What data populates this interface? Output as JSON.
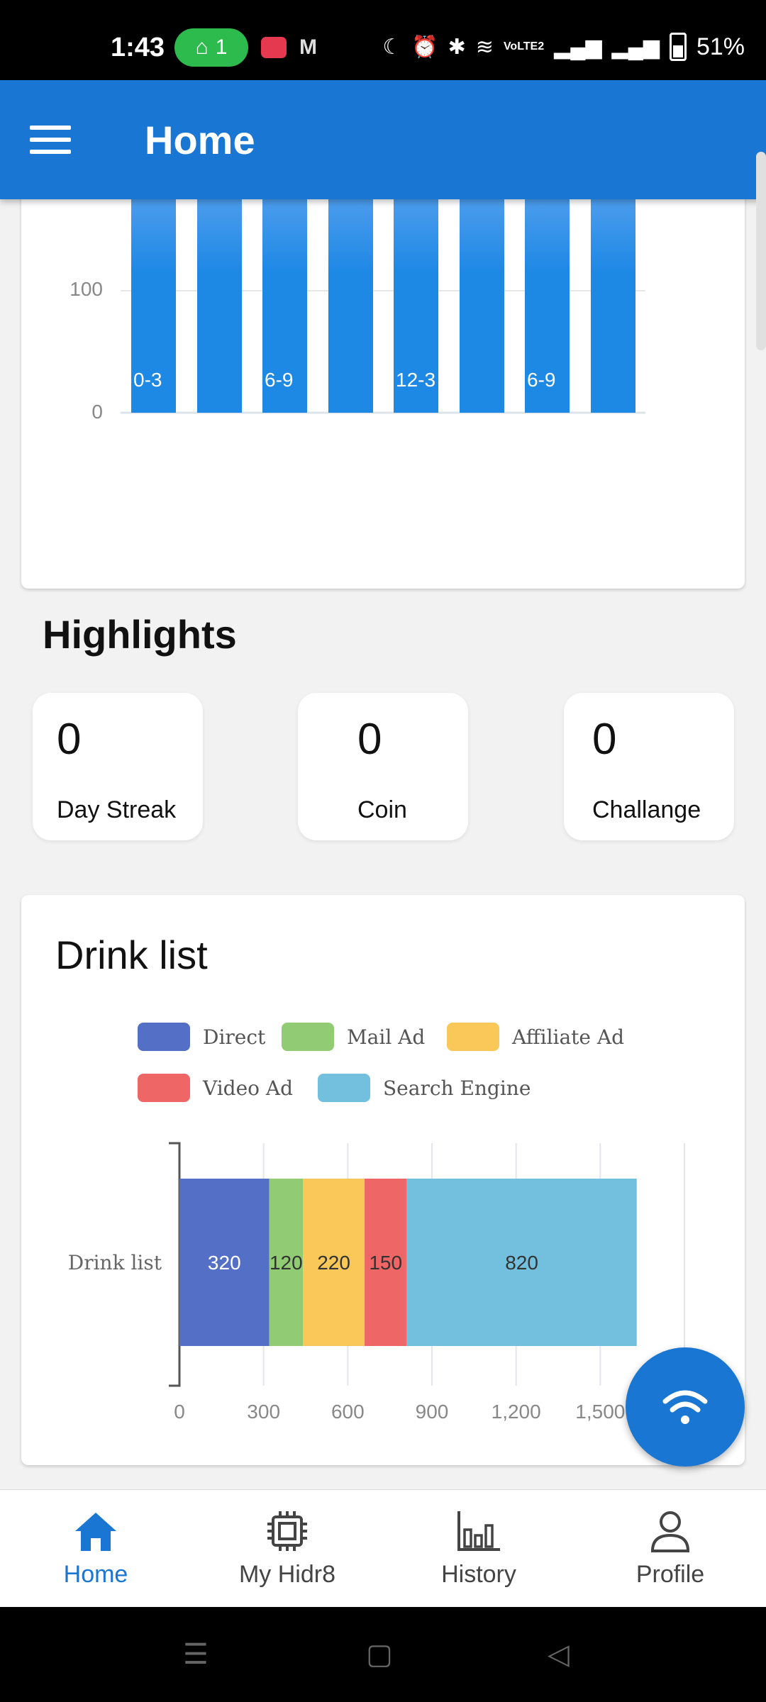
{
  "status_bar": {
    "time": "1:43",
    "hotspot_count": "1",
    "battery": "51%",
    "network": "VoLTE2"
  },
  "app_bar": {
    "title": "Home"
  },
  "usage_chart": {
    "y_ticks": [
      "100",
      "0"
    ],
    "bar_labels": [
      "0-3",
      "",
      "6-9",
      "",
      "12-3",
      "",
      "6-9",
      ""
    ],
    "bar_color": "#1e88e5"
  },
  "highlights": {
    "title": "Highlights",
    "cards": [
      {
        "value": "0",
        "label": "Day Streak"
      },
      {
        "value": "0",
        "label": "Coin"
      },
      {
        "value": "0",
        "label": "Challange"
      }
    ]
  },
  "drink_list": {
    "title": "Drink list",
    "chart_data": {
      "type": "bar",
      "orientation": "horizontal",
      "stacked": true,
      "categories": [
        "Drink list"
      ],
      "series": [
        {
          "name": "Direct",
          "values": [
            320
          ],
          "color": "#5470c6"
        },
        {
          "name": "Mail Ad",
          "values": [
            120
          ],
          "color": "#91cc75"
        },
        {
          "name": "Affiliate Ad",
          "values": [
            220
          ],
          "color": "#fac858"
        },
        {
          "name": "Video Ad",
          "values": [
            150
          ],
          "color": "#ee6666"
        },
        {
          "name": "Search Engine",
          "values": [
            820
          ],
          "color": "#73c0de"
        }
      ],
      "x_ticks": [
        "0",
        "300",
        "600",
        "900",
        "1,200",
        "1,500"
      ],
      "xlim": [
        0,
        1800
      ],
      "legend_position": "top"
    }
  },
  "bottom_nav": {
    "items": [
      {
        "label": "Home",
        "icon": "home-icon",
        "active": true
      },
      {
        "label": "My Hidr8",
        "icon": "chip-icon",
        "active": false
      },
      {
        "label": "History",
        "icon": "bar-chart-icon",
        "active": false
      },
      {
        "label": "Profile",
        "icon": "person-icon",
        "active": false
      }
    ],
    "active_color": "#1976d2",
    "inactive_color": "#444444"
  }
}
